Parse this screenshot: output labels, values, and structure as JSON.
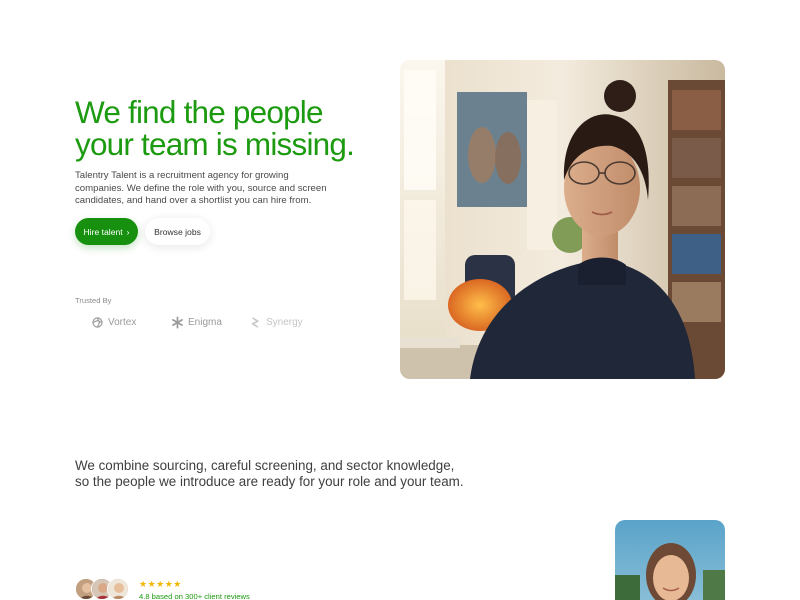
{
  "hero": {
    "title_line1": "We find the people",
    "title_line2": "your team is missing.",
    "description": "Talentry Talent is a recruitment agency for growing companies. We define the role with you, source and screen candidates, and hand over a shortlist you can hire from.",
    "primary_button": "Hire talent",
    "primary_button_icon": "›",
    "secondary_button": "Browse jobs",
    "accent_color": "#1c9a10"
  },
  "trusted": {
    "label": "Trusted By",
    "logos": [
      {
        "name": "Vortex",
        "icon": "vortex-logo-icon"
      },
      {
        "name": "Enigma",
        "icon": "enigma-logo-icon"
      },
      {
        "name": "Synergy",
        "icon": "synergy-logo-icon"
      }
    ]
  },
  "mission": {
    "line1": "We combine sourcing, careful screening, and sector knowledge,",
    "line2": "so the people we introduce are ready for your role and your team."
  },
  "reviews": {
    "stars": "★★★★★",
    "rating_text": "4.8 based on 300+ client reviews",
    "star_color": "#f2b705"
  }
}
